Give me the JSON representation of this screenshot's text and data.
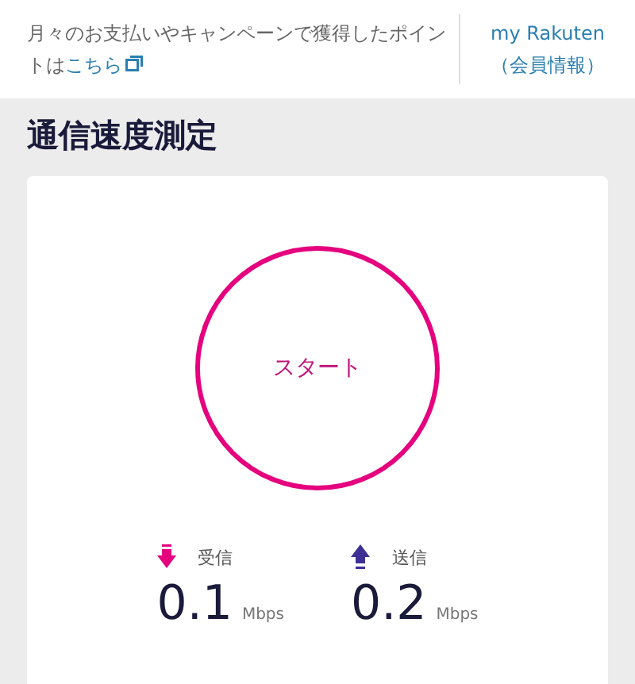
{
  "notice": {
    "text": "月々のお支払いやキャンペーンで獲得したポイントは",
    "link": "こちら"
  },
  "account_link": {
    "line_1": "my Rakuten",
    "line_2": "（会員情報）"
  },
  "title": "通信速度測定",
  "start_button": {
    "label": "スタート"
  },
  "metrics": [
    {
      "kind": "download",
      "label": "受信",
      "value": "0.1",
      "unit": "Mbps"
    },
    {
      "kind": "upload",
      "label": "送信",
      "value": "0.2",
      "unit": "Mbps"
    }
  ]
}
